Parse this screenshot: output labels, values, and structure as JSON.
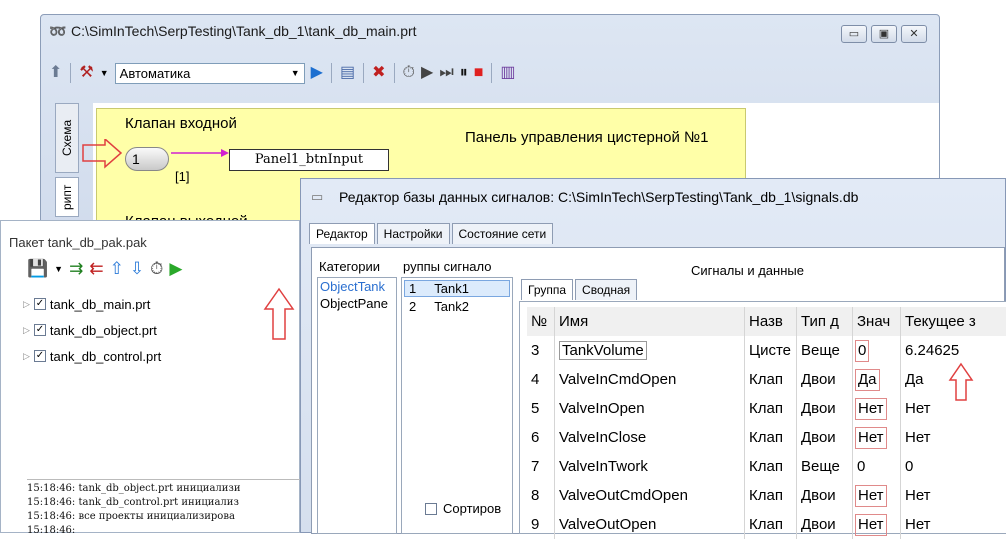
{
  "main": {
    "title": "C:\\SimInTech\\SerpTesting\\Tank_db_1\\tank_db_main.prt",
    "mode": "Автоматика",
    "tab_scheme": "Схема",
    "tab_script": "рипт",
    "valve_in": "Клапан входной",
    "valve_out": "Клапан выходной",
    "panel_title": "Панель управления цистерной №1",
    "input_block": "Panel1_btnInput",
    "port_label": "[1]",
    "btn_val": "1"
  },
  "pak": {
    "title": "Пакет  tank_db_pak.pak",
    "files": [
      "tank_db_main.prt",
      "tank_db_object.prt",
      "tank_db_control.prt"
    ],
    "log": [
      "15:18:46: tank_db_object.prt инициализи",
      "15:18:46: tank_db_control.prt инициализ",
      "15:18:46:  все проекты инициализирова",
      "15:18:46: "
    ]
  },
  "sig": {
    "title": "Редактор базы данных сигналов: C:\\SimInTech\\SerpTesting\\Tank_db_1\\signals.db",
    "tabs": [
      "Редактор",
      "Настройки",
      "Состояние сети"
    ],
    "cat_header": "Категории",
    "categories": [
      "ObjectTank",
      "ObjectPane"
    ],
    "groups_header": "руппы сигнало",
    "groups": [
      {
        "n": "1",
        "name": "Tank1"
      },
      {
        "n": "2",
        "name": "Tank2"
      }
    ],
    "signals_header": "Сигналы и данные",
    "subtabs": [
      "Группа",
      "Сводная"
    ],
    "sort_label": "Сортиров",
    "columns": [
      "№",
      "Имя",
      "Назв",
      "Тип д",
      "Знач",
      "Текущее з"
    ],
    "rows": [
      {
        "n": "3",
        "name": "TankVolume",
        "desc": "Цисте",
        "type": "Веще",
        "val": "0",
        "cur": "6.24625"
      },
      {
        "n": "4",
        "name": "ValveInCmdOpen",
        "desc": "Клап",
        "type": "Двои",
        "val": "Да",
        "cur": "Да"
      },
      {
        "n": "5",
        "name": "ValveInOpen",
        "desc": "Клап",
        "type": "Двои",
        "val": "Нет",
        "cur": "Нет"
      },
      {
        "n": "6",
        "name": "ValveInClose",
        "desc": "Клап",
        "type": "Двои",
        "val": "Нет",
        "cur": "Нет"
      },
      {
        "n": "7",
        "name": "ValveInTwork",
        "desc": "Клап",
        "type": "Веще",
        "val": "0",
        "cur": "0"
      },
      {
        "n": "8",
        "name": "ValveOutCmdOpen",
        "desc": "Клап",
        "type": "Двои",
        "val": "Нет",
        "cur": "Нет"
      },
      {
        "n": "9",
        "name": "ValveOutOpen",
        "desc": "Клап",
        "type": "Двои",
        "val": "Нет",
        "cur": "Нет"
      }
    ]
  }
}
